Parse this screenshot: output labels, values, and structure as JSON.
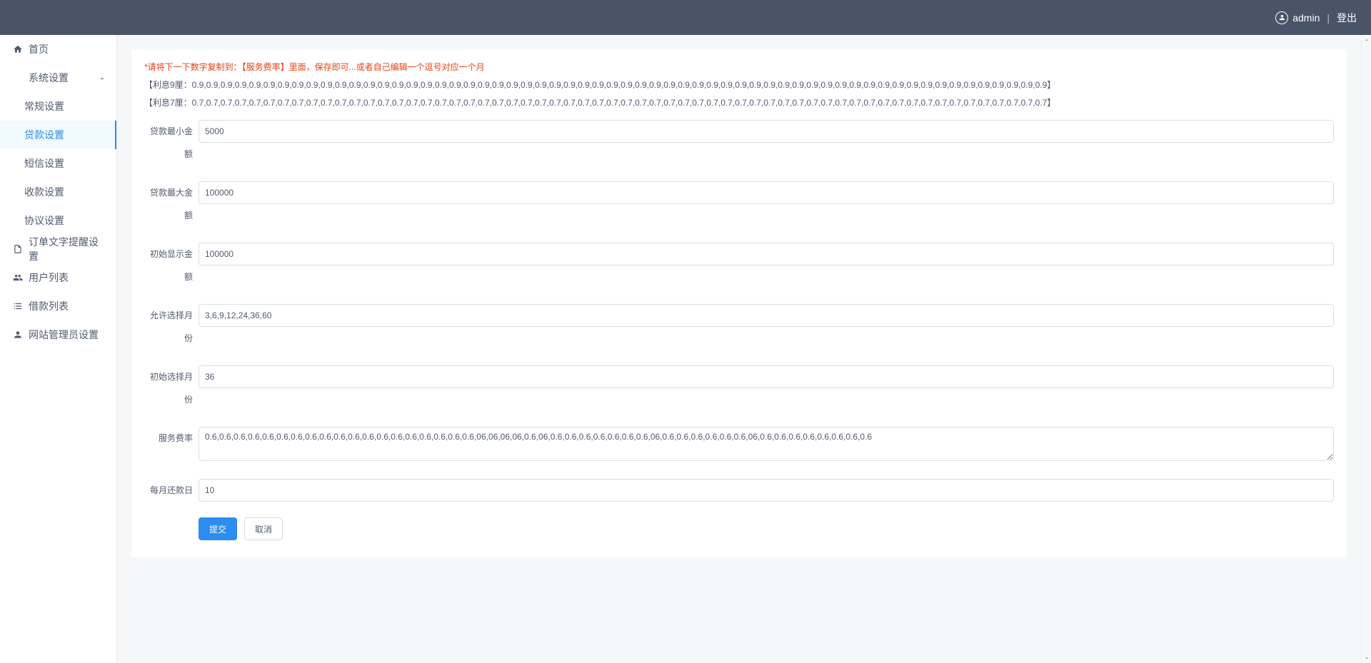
{
  "header": {
    "user": "admin",
    "logout": "登出"
  },
  "sidebar": {
    "home": "首页",
    "system_settings": "系统设置",
    "system_children": {
      "general": "常规设置",
      "loan": "贷款设置",
      "sms": "短信设置",
      "payment": "收款设置",
      "agreement": "协议设置"
    },
    "order_text": "订单文字提醒设置",
    "user_list": "用户列表",
    "borrow_list": "借款列表",
    "admin_settings": "网站管理员设置"
  },
  "content": {
    "hint": "*请将下一下数字复制到：【服务费率】里面，保存即可...或者自己编辑一个逗号对应一个月",
    "rate9": "【利息9厘：0.9,0.9,0.9,0.9,0.9,0.9,0.9,0.9,0.9,0.9,0.9,0.9,0.9,0.9,0.9,0.9,0.9,0.9,0.9,0.9,0.9,0.9,0.9,0.9,0.9,0.9,0.9,0.9,0.9,0.9,0.9,0.9,0.9,0.9,0.9,0.9,0.9,0.9,0.9,0.9,0.9,0.9,0.9,0.9,0.9,0.9,0.9,0.9,0.9,0.9,0.9,0.9,0.9,0.9,0.9,0.9,0.9,0.9,0.9,0.9】",
    "rate7": "【利息7厘：0.7,0.7,0.7,0.7,0.7,0.7,0.7,0.7,0.7,0.7,0.7,0.7,0.7,0.7,0.7,0.7,0.7,0.7,0.7,0.7,0.7,0.7,0.7,0.7,0.7,0.7,0.7,0.7,0.7,0.7,0.7,0.7,0.7,0.7,0.7,0.7,0.7,0.7,0.7,0.7,0.7,0.7,0.7,0.7,0.7,0.7,0.7,0.7,0.7,0.7,0.7,0.7,0.7,0.7,0.7,0.7,0.7,0.7,0.7,0.7】"
  },
  "form": {
    "labels": {
      "min_amount": "贷款最小金额",
      "max_amount": "贷款最大金额",
      "init_display_amount": "初始显示金额",
      "allowed_months": "允许选择月份",
      "init_month": "初始选择月份",
      "service_rate": "服务费率",
      "repay_day": "每月还款日"
    },
    "values": {
      "min_amount": "5000",
      "max_amount": "100000",
      "init_display_amount": "100000",
      "allowed_months": "3,6,9,12,24,36,60",
      "init_month": "36",
      "service_rate": "0.6,0.6,0.6,0.6,0.6,0.6,0.6,0.6,0.6,0.6,0.6,0.6,0.6,0.6,0.6,0.6,0.6,0.6,0.6,06,06,06,06,0.6,06,0.6,0.6,0.6,0.6,0.6,0.6,0.6,06,0.6,0.6,0.6,0.6,0.6,0.6,06,0.6,0.6,0.6,0.6,0.6,0.6,0.6,0.6",
      "repay_day": "10"
    },
    "buttons": {
      "submit": "提交",
      "cancel": "取消"
    }
  }
}
